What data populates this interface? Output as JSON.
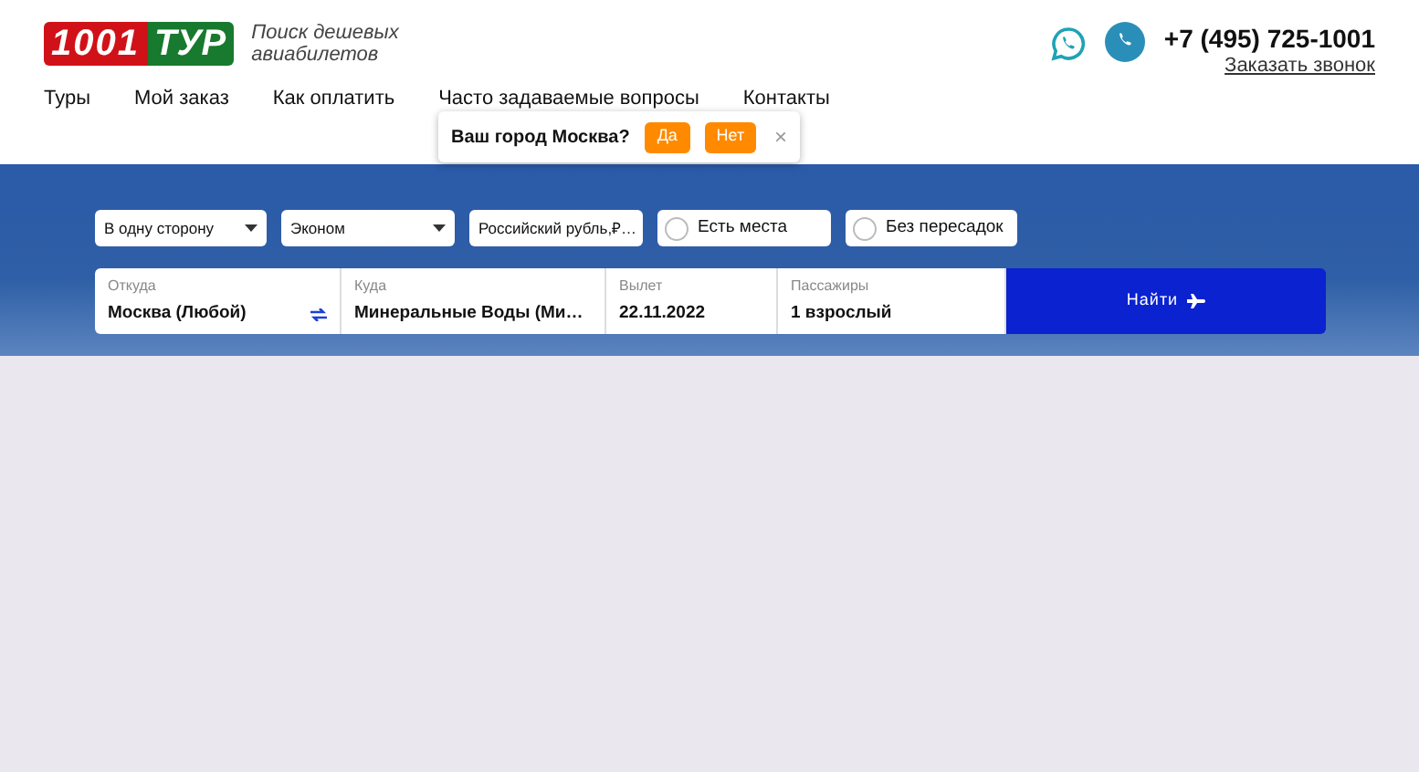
{
  "logo": {
    "digits": "1001",
    "word": "ТУР"
  },
  "tagline": "Поиск дешевых авиабилетов",
  "phone": "+7 (495) 725-1001",
  "callback_link": "Заказать звонок",
  "nav": [
    "Туры",
    "Мой заказ",
    "Как оплатить",
    "Часто задаваемые вопросы",
    "Контакты"
  ],
  "city_popup": {
    "question": "Ваш город Москва?",
    "yes": "Да",
    "no": "Нет",
    "close": "×"
  },
  "filters": [
    {
      "kind": "select",
      "value": "В одну сторону"
    },
    {
      "kind": "select",
      "value": "Эконом"
    },
    {
      "kind": "select",
      "value": "Российский рубль,₽…"
    },
    {
      "kind": "checkbox",
      "label": "Есть места",
      "checked": false
    },
    {
      "kind": "checkbox",
      "label": "Без пересадок",
      "checked": false
    }
  ],
  "search": [
    {
      "label": "Откуда",
      "value": "Москва (Любой)",
      "swap": true
    },
    {
      "label": "Куда",
      "value": "Минеральные Воды (Ми…",
      "swap": false
    },
    {
      "label": "Вылет",
      "value": "22.11.2022",
      "swap": false
    },
    {
      "label": "Пассажиры",
      "value": "1 взрослый",
      "swap": false
    }
  ],
  "search_button": "Найти"
}
